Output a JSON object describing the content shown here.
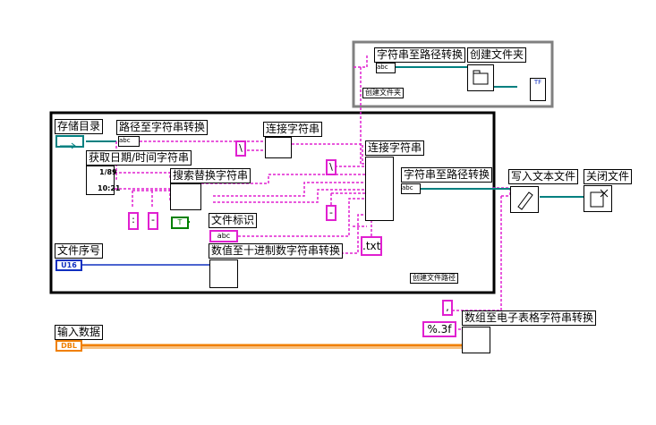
{
  "labels": {
    "storage_dir": "存储目录",
    "path_to_string": "路径至字符串转换",
    "concat_string_top": "连接字符串",
    "get_datetime": "获取日期/时间字符串",
    "search_replace": "搜索替换字符串",
    "concat_string_main": "连接字符串",
    "string_to_path": "字符串至路径转换",
    "write_text_file": "写入文本文件",
    "close_file": "关闭文件",
    "file_tag": "文件标识",
    "file_serial": "文件序号",
    "num_to_dec_string": "数值至十进制数字符串转换",
    "input_data": "输入数据",
    "array_to_spreadsheet": "数组至电子表格字符串转换",
    "string_to_path_top": "字符串至路径转换",
    "create_folder": "创建文件夹",
    "create_folder_caption": "创建文件夹",
    "create_file_path_caption": "创建文件路径"
  },
  "constants": {
    "backslash_1": "\\",
    "backslash_2": "\\",
    "colon": ":",
    "dash_1": "-",
    "dash_2": "-",
    "txt_ext": ".txt",
    "comma": ",",
    "format": "%.3f"
  },
  "terminals": {
    "u16": "U16",
    "dbl": "DBL",
    "abc": "abc",
    "bool_true": "T",
    "tf": "TF",
    "date_fmt": "1/89",
    "time_fmt": "10:21"
  },
  "colors": {
    "string_wire": "#e020d0",
    "path_wire": "#008080",
    "int_wire": "#1030c0",
    "dbl_wire": "#f08000",
    "bool_wire": "#008000"
  }
}
